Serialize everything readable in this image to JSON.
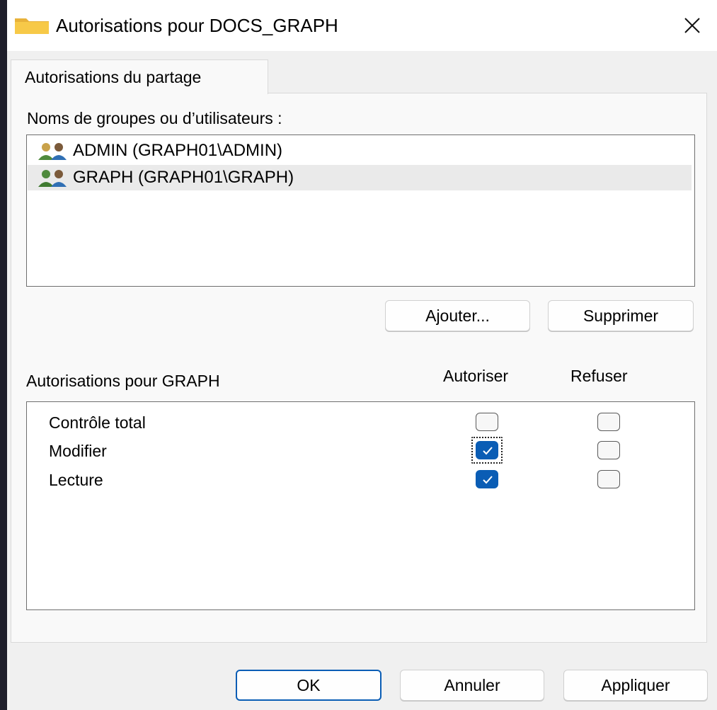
{
  "window": {
    "title": "Autorisations pour DOCS_GRAPH"
  },
  "tabs": [
    {
      "label": "Autorisations du partage",
      "active": true
    }
  ],
  "groups_section": {
    "label": "Noms de groupes ou d’utilisateurs :",
    "items": [
      {
        "label": "ADMIN (GRAPH01\\ADMIN)",
        "icon": "users-group-icon",
        "selected": false
      },
      {
        "label": "GRAPH (GRAPH01\\GRAPH)",
        "icon": "users-group-icon",
        "selected": true
      }
    ],
    "add_button": "Ajouter...",
    "remove_button": "Supprimer"
  },
  "permissions_section": {
    "label": "Autorisations pour GRAPH",
    "allow_header": "Autoriser",
    "deny_header": "Refuser",
    "rows": [
      {
        "name": "Contrôle total",
        "allow": false,
        "deny": false
      },
      {
        "name": "Modifier",
        "allow": true,
        "deny": false
      },
      {
        "name": "Lecture",
        "allow": true,
        "deny": false
      }
    ]
  },
  "footer": {
    "ok": "OK",
    "cancel": "Annuler",
    "apply": "Appliquer"
  },
  "colors": {
    "accent": "#0a5db5",
    "folder": "#f7c948"
  }
}
